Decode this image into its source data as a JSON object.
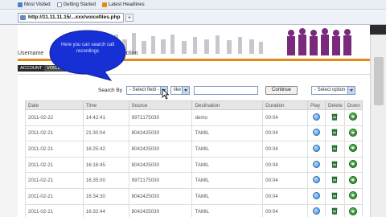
{
  "browser": {
    "bookmarks": [
      {
        "label": "Most Visited",
        "icon": "blue"
      },
      {
        "label": "Getting Started",
        "icon": "page"
      },
      {
        "label": "Latest Headlines",
        "icon": "rss"
      }
    ],
    "url": "http://11.11.11.15/...xxx/voicefiles.php"
  },
  "site": {
    "nav_username": "Username",
    "nav_action": "Action",
    "submenu": [
      "ACCOUNT",
      "VOICE FILES"
    ]
  },
  "search": {
    "label": "Search By",
    "field_placeholder": "- Select field -",
    "operator": "like",
    "query": "",
    "continue_label": "Continue",
    "option_placeholder": "- Select option -"
  },
  "tooltip": {
    "text": "Here you can search call recordings"
  },
  "table": {
    "columns": [
      "Date",
      "Time",
      "Source",
      "Destination",
      "Duration",
      "Play",
      "Delete",
      "Down"
    ],
    "rows": [
      {
        "date": "2011-02-22",
        "time": "14:42:41",
        "source": "9972175030",
        "destination": "demo",
        "duration": "00:04"
      },
      {
        "date": "2011-02-21",
        "time": "21:30:04",
        "source": "8042425030",
        "destination": "TAMIL",
        "duration": "00:04"
      },
      {
        "date": "2011-02-21",
        "time": "16:25:42",
        "source": "8042425030",
        "destination": "TAMIL",
        "duration": "00:04"
      },
      {
        "date": "2011-02-21",
        "time": "16:16:45",
        "source": "8042425030",
        "destination": "TAMIL",
        "duration": "00:04"
      },
      {
        "date": "2011-02-21",
        "time": "16:35:00",
        "source": "9972175030",
        "destination": "TAMIL",
        "duration": "00:04"
      },
      {
        "date": "2011-02-21",
        "time": "16:34:30",
        "source": "8042425030",
        "destination": "TAMIL",
        "duration": "00:04"
      },
      {
        "date": "2011-02-21",
        "time": "16:32:44",
        "source": "8042425030",
        "destination": "TAMIL",
        "duration": "00:04"
      }
    ]
  },
  "colors": {
    "accent_orange": "#e48a12",
    "tooltip_blue": "#1730d6",
    "header_people": "#7a2a7a"
  },
  "icons": [
    "play-icon",
    "delete-icon",
    "download-icon"
  ]
}
